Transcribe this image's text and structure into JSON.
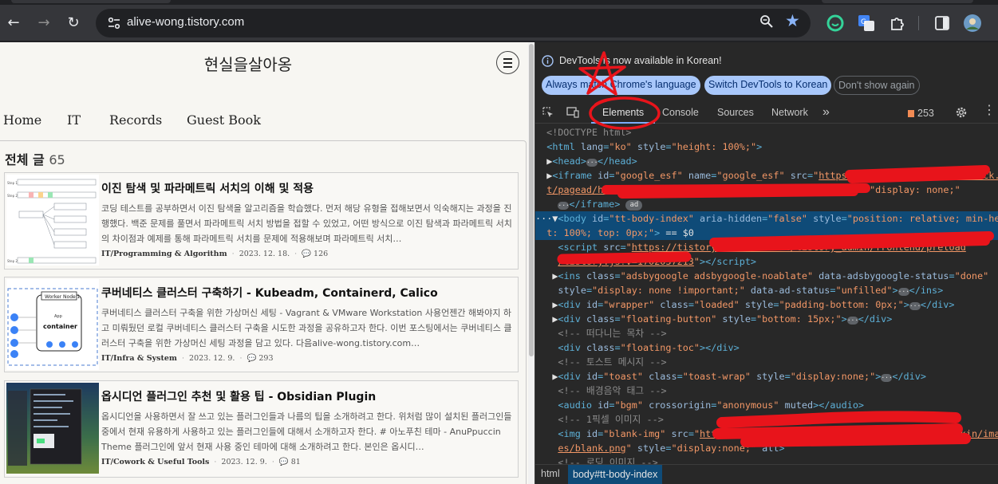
{
  "browser": {
    "url": "alive-wong.tistory.com",
    "back_icon": "←",
    "forward_icon": "→",
    "reload_icon": "↻"
  },
  "blog": {
    "title": "현실을살아옹",
    "nav": [
      "Home",
      "IT",
      "Records",
      "Guest Book"
    ],
    "all_posts_label": "전체 글",
    "all_posts_count": "65",
    "posts": [
      {
        "title": "이진 탐색 및 파라메트릭 서치의 이해 및 적용",
        "desc": "코딩 테스트를 공부하면서 이진 탐색을 알고리즘을 학습했다. 먼저 해당 유형을 접해보면서 익숙해지는 과정을 진행했다. 백준 문제를 풀면서 파라메트릭 서치 방법을 접할 수 있었고, 어떤 방식으로 이진 탐색과 파라메트릭 서치의 차이점과 예제를 통해 파라메트릭 서치를 문제에 적용해보며 파라메트릭 서치…",
        "category": "IT/Programming & Algorithm",
        "date": "2023. 12. 18.",
        "comments": "126"
      },
      {
        "title": "쿠버네티스 클러스터 구축하기 - Kubeadm, Containerd, Calico",
        "desc": "쿠버네티스 클러스터 구축을 위한 가상머신 세팅 - Vagrant & VMware Workstation 사용언젠간 해봐야지 하고 미뤄뒀던 로컬 쿠버네티스 클러스터 구축을 시도한 과정을 공유하고자 한다. 이번 포스팅에서는 쿠버네티스 클러스터 구축을 위한 가상머신 세팅 과정을 담고 있다. 다음alive-wong.tistory.com…",
        "category": "IT/Infra & System",
        "date": "2023. 12. 9.",
        "comments": "293"
      },
      {
        "title": "옵시디언 플러그인 추천 및 활용 팁 - Obsidian Plugin",
        "desc": "옵시디언을 사용하면서 잘 쓰고 있는 플러그인들과 나름의 팁을 소개하려고 한다. 위처럼 많이 설치된 플러그인들 중에서 현재 유용하게 사용하고 있는 플러그인들에 대해서 소개하고자 한다. # 아노푸친 테마 - AnuPpuccin Theme 플러그인에 앞서 현재 사용 중인 테마에 대해 소개하려고 한다. 본인은 옵시디…",
        "category": "IT/Cowork & Useful Tools",
        "date": "2023. 12. 9.",
        "comments": "81"
      }
    ],
    "thumb2_labels": {
      "worker": "Worker Node 1",
      "app": "App",
      "container": "container"
    }
  },
  "devtools": {
    "info_text": "DevTools is now available in Korean!",
    "btn_match": "Always match Chrome's language",
    "btn_switch": "Switch DevTools to Korean",
    "btn_dismiss": "Don't show again",
    "tabs": [
      "Elements",
      "Console",
      "Sources",
      "Network"
    ],
    "more_tabs": "»",
    "issues_count": "253",
    "breadcrumbs": [
      "html",
      "body#tt-body-index"
    ],
    "dom_lines": {
      "l0": "<!DOCTYPE html>",
      "l14": "<!-- 떠다니는 목차 -->",
      "l16": "<!-- 토스트 메시지 -->",
      "l18": "<!-- 배경음악 태그 -->",
      "l20": "<!-- 1픽셀 이미지 -->",
      "l23": "<!-- 로딩 이미지 -->"
    }
  },
  "colors": {
    "chrome_bg": "#35363a",
    "omnibox_bg": "#202124",
    "devtools_bg": "#282828",
    "selected_row": "#0f4b78",
    "annotation_red": "#e8141b",
    "accent_blue": "#a8c7fa"
  }
}
